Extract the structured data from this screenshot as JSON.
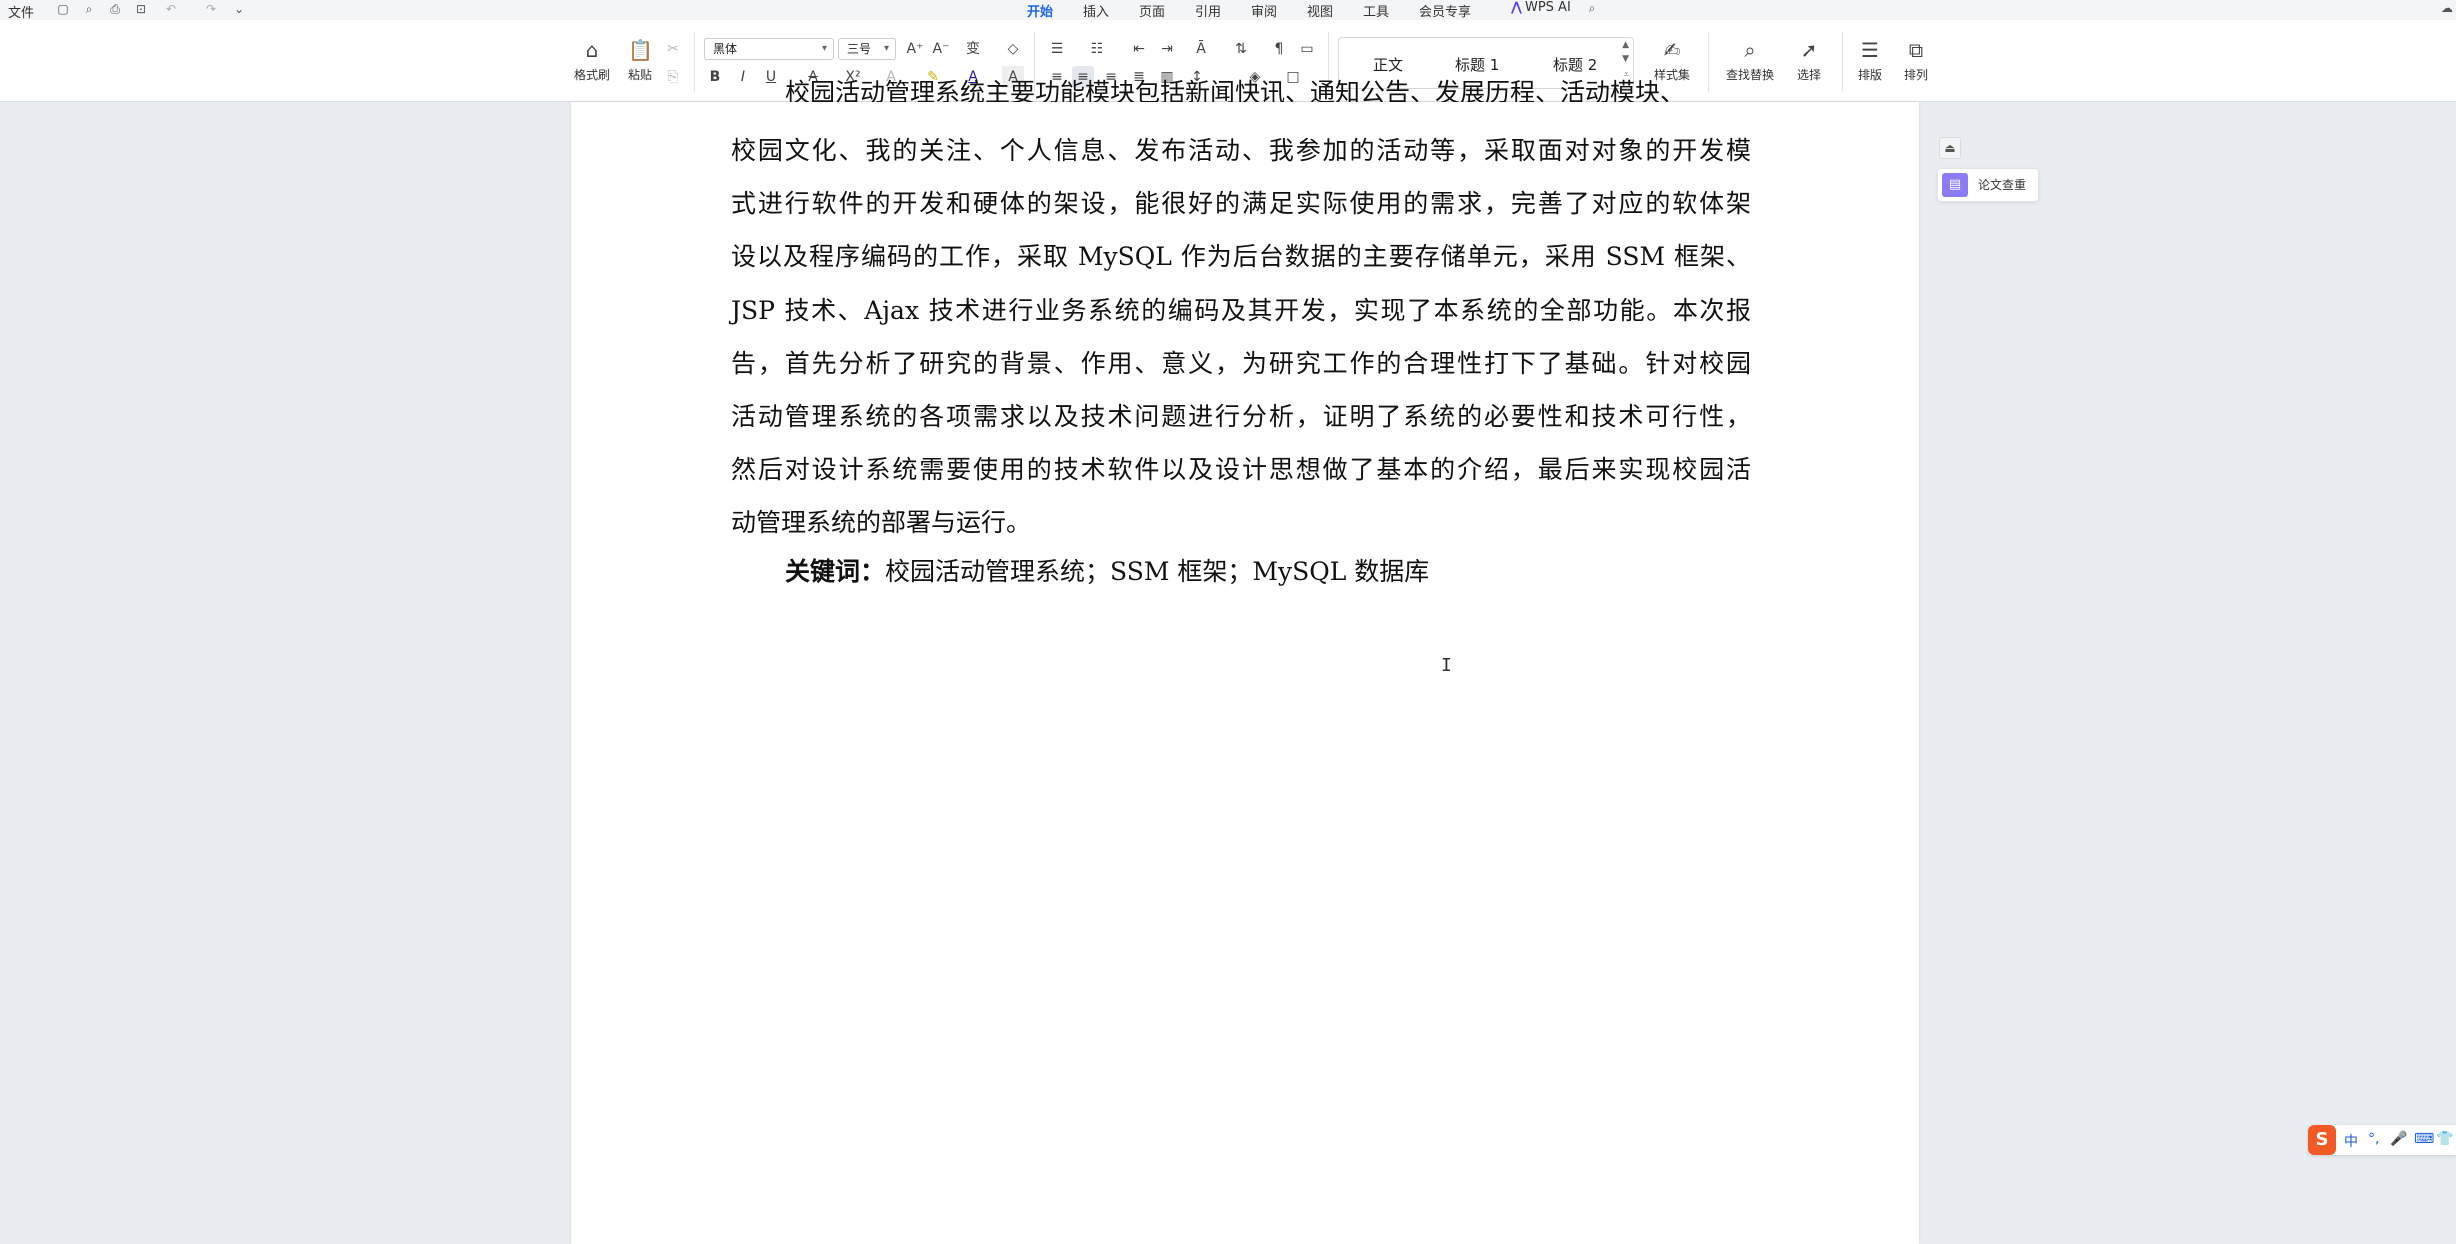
{
  "menubar": {
    "file_label": "文件",
    "tabs": [
      "开始",
      "插入",
      "页面",
      "引用",
      "审阅",
      "视图",
      "工具",
      "会员专享"
    ],
    "active_tab": "开始",
    "wps_ai_label": "WPS AI"
  },
  "ribbon": {
    "format_painter": "格式刷",
    "paste": "粘贴",
    "font_name": "黑体",
    "font_size": "三号",
    "styles": [
      "正文",
      "标题 1",
      "标题 2"
    ],
    "style_set": "样式集",
    "find_replace": "查找替换",
    "select": "选择",
    "layout": "排版",
    "arrange": "排列"
  },
  "document": {
    "cut_line": "校园活动管理系统主要功能模块包括新闻快讯、通知公告、发展历程、活动模块、",
    "lines": [
      "校园文化、我的关注、个人信息、发布活动、我参加的活动等，采取面对对象的开发模",
      "式进行软件的开发和硬体的架设，能很好的满足实际使用的需求，完善了对应的软体架",
      "设以及程序编码的工作，采取 MySQL 作为后台数据的主要存储单元，采用 SSM 框架、",
      "JSP 技术、Ajax 技术进行业务系统的编码及其开发，实现了本系统的全部功能。本次报",
      "告，首先分析了研究的背景、作用、意义，为研究工作的合理性打下了基础。针对校园",
      "活动管理系统的各项需求以及技术问题进行分析，证明了系统的必要性和技术可行性，",
      "然后对设计系统需要使用的技术软件以及设计思想做了基本的介绍，最后来实现校园活",
      "动管理系统的部署与运行。"
    ],
    "keywords_label": "关键词：",
    "keywords_text": "校园活动管理系统；SSM 框架；MySQL 数据库"
  },
  "sidebar": {
    "plagiarism_check": "论文查重"
  },
  "ime": {
    "items": [
      "中",
      "°,",
      "🎤",
      "⌨",
      "👕"
    ]
  }
}
